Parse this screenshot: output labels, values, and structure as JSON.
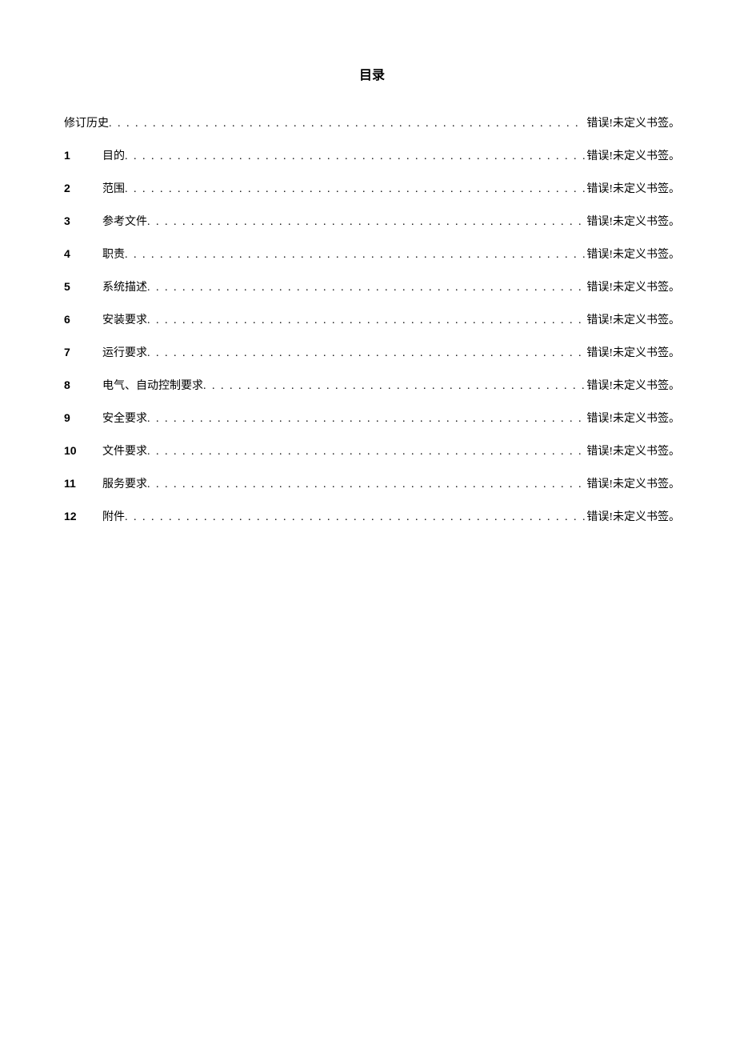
{
  "title": "目录",
  "error_text": "错误!未定义书签。",
  "entries": [
    {
      "num": "",
      "label": "修订历史"
    },
    {
      "num": "1",
      "label": "目的"
    },
    {
      "num": "2",
      "label": "范围"
    },
    {
      "num": "3",
      "label": "参考文件"
    },
    {
      "num": "4",
      "label": "职责"
    },
    {
      "num": "5",
      "label": "系统描述"
    },
    {
      "num": "6",
      "label": "安装要求"
    },
    {
      "num": "7",
      "label": "运行要求"
    },
    {
      "num": "8",
      "label": "电气、自动控制要求"
    },
    {
      "num": "9",
      "label": "安全要求"
    },
    {
      "num": "10",
      "label": "文件要求"
    },
    {
      "num": "11",
      "label": "服务要求"
    },
    {
      "num": "12",
      "label": "附件"
    }
  ]
}
